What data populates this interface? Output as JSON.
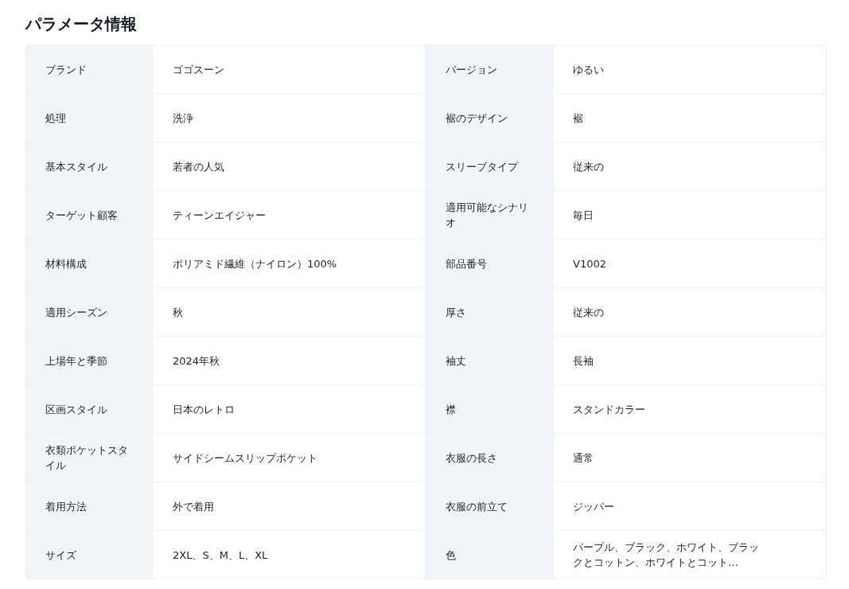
{
  "title": "パラメータ情報",
  "rows": [
    {
      "cells": [
        {
          "label": "ブランド",
          "value": "ゴゴスーン"
        },
        {
          "label": "バージョン",
          "value": "ゆるい"
        }
      ]
    },
    {
      "cells": [
        {
          "label": "処理",
          "value": "洗浄"
        },
        {
          "label": "裾のデザイン",
          "value": "裾"
        }
      ]
    },
    {
      "cells": [
        {
          "label": "基本スタイル",
          "value": "若者の人気"
        },
        {
          "label": "スリーブタイプ",
          "value": "従来の"
        }
      ]
    },
    {
      "cells": [
        {
          "label": "ターゲット顧客",
          "value": "ティーンエイジャー"
        },
        {
          "label": "適用可能なシナリオ",
          "value": "毎日"
        }
      ]
    },
    {
      "cells": [
        {
          "label": "材料構成",
          "value": "ポリアミド繊維（ナイロン）100%"
        },
        {
          "label": "部品番号",
          "value": "V1002"
        }
      ]
    },
    {
      "cells": [
        {
          "label": "適用シーズン",
          "value": "秋"
        },
        {
          "label": "厚さ",
          "value": "従来の"
        }
      ]
    },
    {
      "cells": [
        {
          "label": "上場年と季節",
          "value": "2024年秋"
        },
        {
          "label": "袖丈",
          "value": "長袖"
        }
      ]
    },
    {
      "cells": [
        {
          "label": "区画スタイル",
          "value": "日本のレトロ"
        },
        {
          "label": "襟",
          "value": "スタンドカラー"
        }
      ]
    },
    {
      "cells": [
        {
          "label": "衣類ポケットスタイル",
          "value": "サイドシームスリップポケット"
        },
        {
          "label": "衣服の長さ",
          "value": "通常"
        }
      ]
    },
    {
      "cells": [
        {
          "label": "着用方法",
          "value": "外で着用"
        },
        {
          "label": "衣服の前立て",
          "value": "ジッパー"
        }
      ]
    },
    {
      "cells": [
        {
          "label": "サイズ",
          "value": "2XL、S、M、L、XL"
        },
        {
          "label": "色",
          "value": "パープル、ブラック、ホワイト、ブラックとコットン、ホワイトとコット…"
        }
      ]
    }
  ]
}
